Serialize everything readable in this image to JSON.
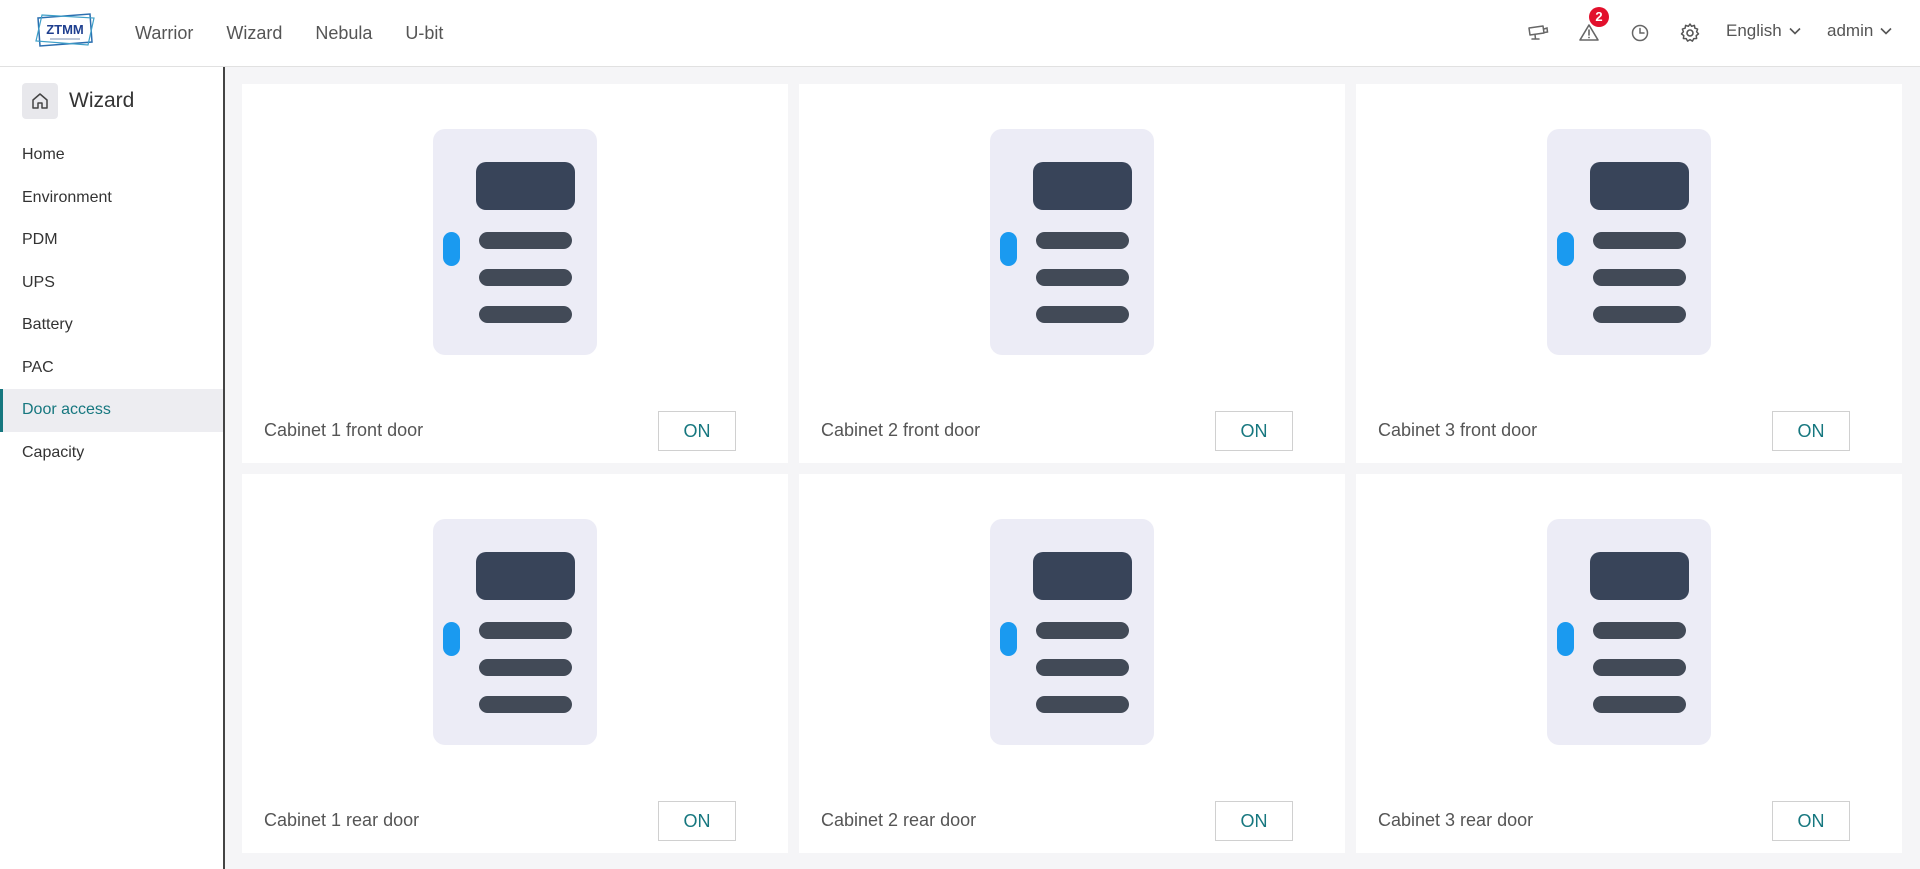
{
  "header": {
    "logo_text": "ZTMM",
    "nav": [
      "Warrior",
      "Wizard",
      "Nebula",
      "U-bit"
    ],
    "alarm_badge": "2",
    "icons": [
      "camera-icon",
      "alarm-icon",
      "history-icon",
      "settings-icon"
    ],
    "language": "English",
    "user": "admin"
  },
  "sidebar": {
    "title": "Wizard",
    "items": [
      {
        "label": "Home"
      },
      {
        "label": "Environment"
      },
      {
        "label": "PDM"
      },
      {
        "label": "UPS"
      },
      {
        "label": "Battery"
      },
      {
        "label": "PAC"
      },
      {
        "label": "Door access",
        "active": true
      },
      {
        "label": "Capacity"
      }
    ]
  },
  "doors": [
    {
      "label": "Cabinet 1 front door",
      "state": "ON"
    },
    {
      "label": "Cabinet 2 front door",
      "state": "ON"
    },
    {
      "label": "Cabinet 3 front door",
      "state": "ON"
    },
    {
      "label": "Cabinet 1 rear door",
      "state": "ON"
    },
    {
      "label": "Cabinet 2 rear door",
      "state": "ON"
    },
    {
      "label": "Cabinet 3 rear door",
      "state": "ON"
    }
  ],
  "colors": {
    "accent": "#16777f",
    "badge": "#e2102c",
    "door_panel": "#ececf6",
    "door_dark": "#384459",
    "door_handle": "#1a9af0"
  }
}
